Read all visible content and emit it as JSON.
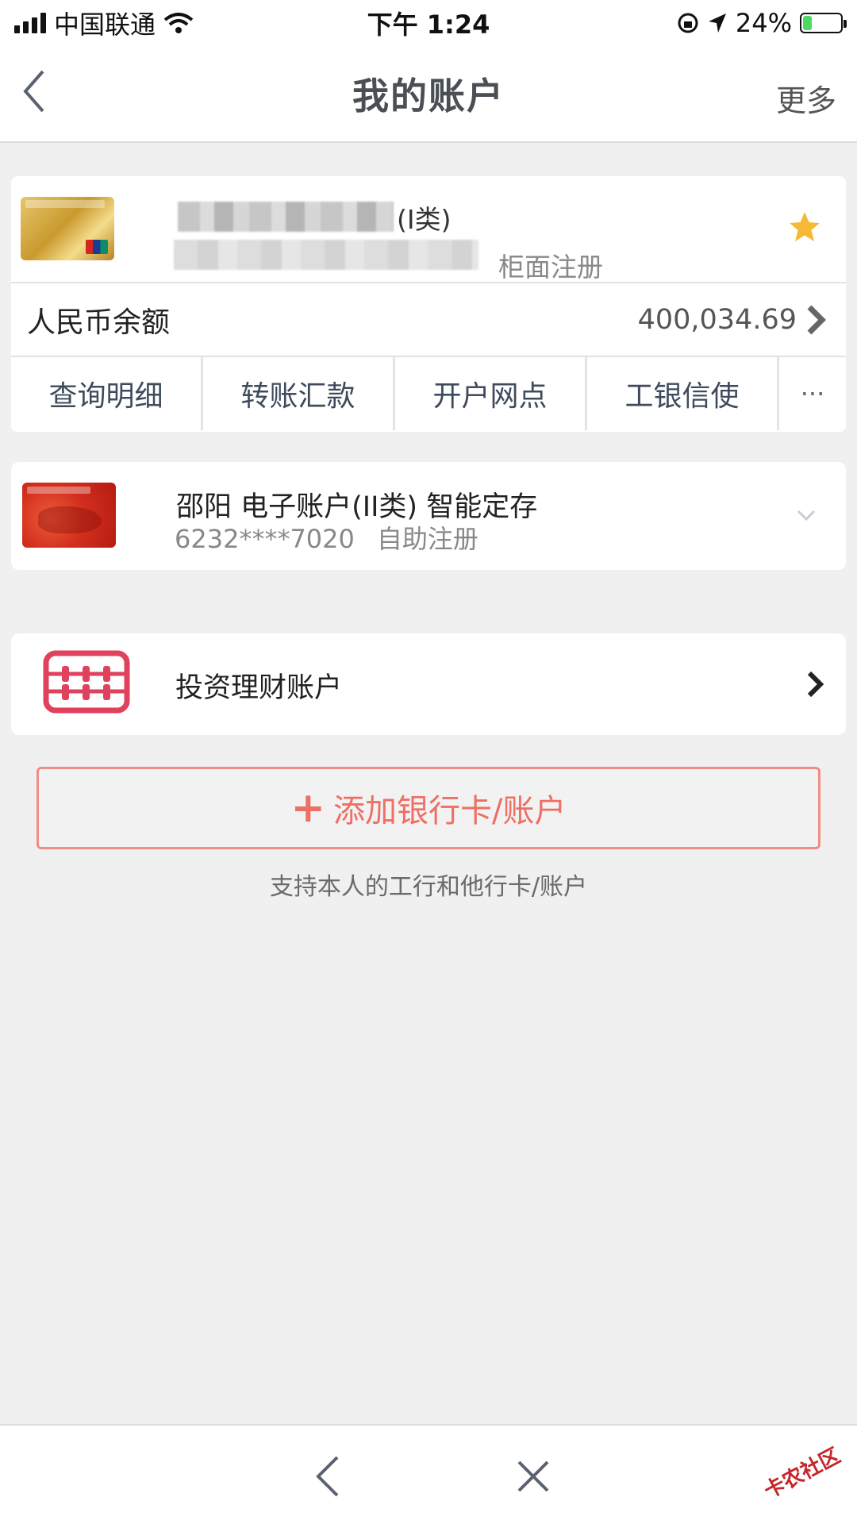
{
  "status_bar": {
    "carrier": "中国联通",
    "time": "下午 1:24",
    "battery": "24%",
    "battery_level": 0.24
  },
  "nav": {
    "title": "我的账户",
    "more": "更多"
  },
  "primary_card": {
    "type_suffix": "(I类)",
    "registration": "柜面注册",
    "balance_label": "人民币余额",
    "balance_value": "400,034.69",
    "actions": [
      "查询明细",
      "转账汇款",
      "开户网点",
      "工银信使"
    ],
    "more_actions": "···"
  },
  "secondary_card": {
    "title": "邵阳 电子账户(II类) 智能定存",
    "number": "6232****7020",
    "registration": "自助注册"
  },
  "invest": {
    "label": "投资理财账户"
  },
  "add": {
    "plus": "+",
    "label": "添加银行卡/账户",
    "hint": "支持本人的工行和他行卡/账户"
  },
  "watermark": "卡农社区",
  "colors": {
    "accent_red": "#ee6f64",
    "star": "#f5b935",
    "battery_green": "#4cd964"
  }
}
